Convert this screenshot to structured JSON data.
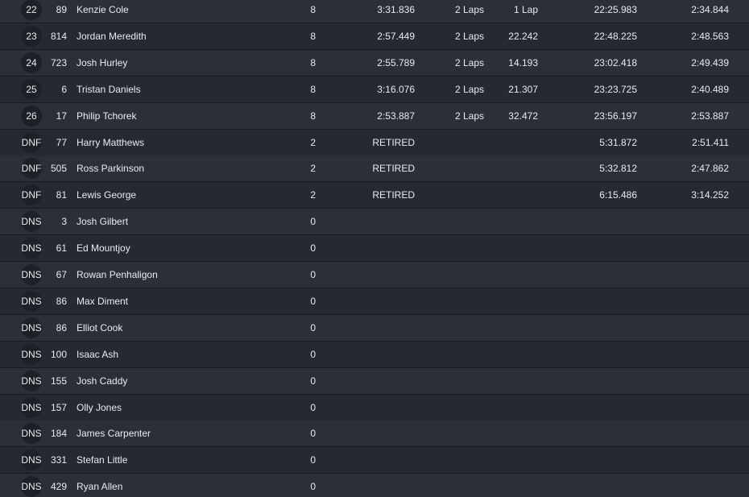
{
  "rows": [
    {
      "pos": "22",
      "num": "89",
      "name": "Kenzie Cole",
      "laps": "8",
      "best": "3:31.836",
      "gap": "2 Laps",
      "diff": "1 Lap",
      "total": "22:25.983",
      "last": "2:34.844"
    },
    {
      "pos": "23",
      "num": "814",
      "name": "Jordan Meredith",
      "laps": "8",
      "best": "2:57.449",
      "gap": "2 Laps",
      "diff": "22.242",
      "total": "22:48.225",
      "last": "2:48.563"
    },
    {
      "pos": "24",
      "num": "723",
      "name": "Josh Hurley",
      "laps": "8",
      "best": "2:55.789",
      "gap": "2 Laps",
      "diff": "14.193",
      "total": "23:02.418",
      "last": "2:49.439"
    },
    {
      "pos": "25",
      "num": "6",
      "name": "Tristan Daniels",
      "laps": "8",
      "best": "3:16.076",
      "gap": "2 Laps",
      "diff": "21.307",
      "total": "23:23.725",
      "last": "2:40.489"
    },
    {
      "pos": "26",
      "num": "17",
      "name": "Philip Tchorek",
      "laps": "8",
      "best": "2:53.887",
      "gap": "2 Laps",
      "diff": "32.472",
      "total": "23:56.197",
      "last": "2:53.887"
    },
    {
      "pos": "DNF",
      "num": "77",
      "name": "Harry Matthews",
      "laps": "2",
      "best": "RETIRED",
      "gap": "",
      "diff": "",
      "total": "5:31.872",
      "last": "2:51.411"
    },
    {
      "pos": "DNF",
      "num": "505",
      "name": "Ross Parkinson",
      "laps": "2",
      "best": "RETIRED",
      "gap": "",
      "diff": "",
      "total": "5:32.812",
      "last": "2:47.862"
    },
    {
      "pos": "DNF",
      "num": "81",
      "name": "Lewis George",
      "laps": "2",
      "best": "RETIRED",
      "gap": "",
      "diff": "",
      "total": "6:15.486",
      "last": "3:14.252"
    },
    {
      "pos": "DNS",
      "num": "3",
      "name": "Josh Gilbert",
      "laps": "0",
      "best": "",
      "gap": "",
      "diff": "",
      "total": "",
      "last": ""
    },
    {
      "pos": "DNS",
      "num": "61",
      "name": "Ed Mountjoy",
      "laps": "0",
      "best": "",
      "gap": "",
      "diff": "",
      "total": "",
      "last": ""
    },
    {
      "pos": "DNS",
      "num": "67",
      "name": "Rowan Penhaligon",
      "laps": "0",
      "best": "",
      "gap": "",
      "diff": "",
      "total": "",
      "last": ""
    },
    {
      "pos": "DNS",
      "num": "86",
      "name": "Max Diment",
      "laps": "0",
      "best": "",
      "gap": "",
      "diff": "",
      "total": "",
      "last": ""
    },
    {
      "pos": "DNS",
      "num": "86",
      "name": "Elliot Cook",
      "laps": "0",
      "best": "",
      "gap": "",
      "diff": "",
      "total": "",
      "last": ""
    },
    {
      "pos": "DNS",
      "num": "100",
      "name": "Isaac Ash",
      "laps": "0",
      "best": "",
      "gap": "",
      "diff": "",
      "total": "",
      "last": ""
    },
    {
      "pos": "DNS",
      "num": "155",
      "name": "Josh Caddy",
      "laps": "0",
      "best": "",
      "gap": "",
      "diff": "",
      "total": "",
      "last": ""
    },
    {
      "pos": "DNS",
      "num": "157",
      "name": "Olly Jones",
      "laps": "0",
      "best": "",
      "gap": "",
      "diff": "",
      "total": "",
      "last": ""
    },
    {
      "pos": "DNS",
      "num": "184",
      "name": "James Carpenter",
      "laps": "0",
      "best": "",
      "gap": "",
      "diff": "",
      "total": "",
      "last": ""
    },
    {
      "pos": "DNS",
      "num": "331",
      "name": "Stefan Little",
      "laps": "0",
      "best": "",
      "gap": "",
      "diff": "",
      "total": "",
      "last": ""
    },
    {
      "pos": "DNS",
      "num": "429",
      "name": "Ryan Allen",
      "laps": "0",
      "best": "",
      "gap": "",
      "diff": "",
      "total": "",
      "last": ""
    }
  ]
}
